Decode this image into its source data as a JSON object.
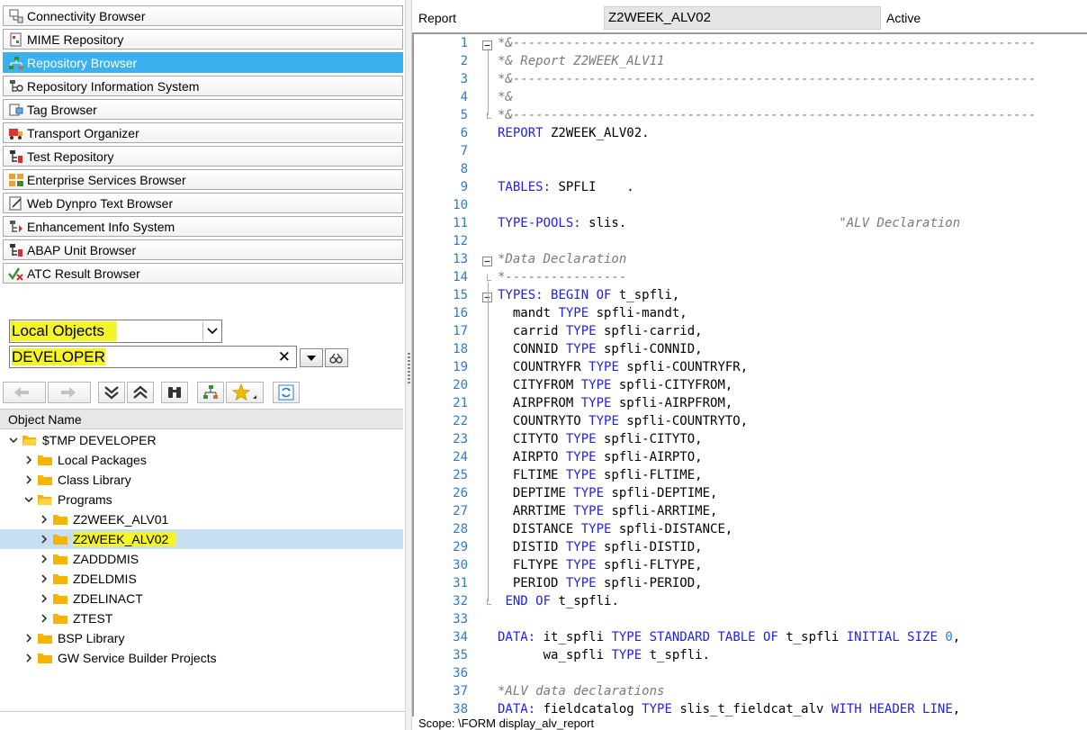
{
  "nav_buttons": [
    {
      "label": "Connectivity Browser",
      "icon": "connectivity-icon",
      "active": false
    },
    {
      "label": "MIME Repository",
      "icon": "mime-repository-icon",
      "active": false
    },
    {
      "label": "Repository Browser",
      "icon": "repository-browser-icon",
      "active": true
    },
    {
      "label": "Repository Information System",
      "icon": "repository-info-icon",
      "active": false
    },
    {
      "label": "Tag Browser",
      "icon": "tag-browser-icon",
      "active": false
    },
    {
      "label": "Transport Organizer",
      "icon": "transport-icon",
      "active": false
    },
    {
      "label": "Test Repository",
      "icon": "test-repository-icon",
      "active": false
    },
    {
      "label": "Enterprise Services Browser",
      "icon": "enterprise-services-icon",
      "active": false
    },
    {
      "label": "Web Dynpro Text Browser",
      "icon": "web-dynpro-icon",
      "active": false
    },
    {
      "label": "Enhancement Info System",
      "icon": "enhancement-icon",
      "active": false
    },
    {
      "label": "ABAP Unit Browser",
      "icon": "abap-unit-icon",
      "active": false
    },
    {
      "label": "ATC Result Browser",
      "icon": "atc-result-icon",
      "active": false
    }
  ],
  "object_selector": {
    "selected": "Local Objects",
    "user_value": "DEVELOPER"
  },
  "tree": {
    "header": "Object Name",
    "rows": [
      {
        "label": "$TMP DEVELOPER",
        "level": 0,
        "expanded": true,
        "selected": false,
        "highlight": false
      },
      {
        "label": "Local Packages",
        "level": 1,
        "expanded": false,
        "selected": false,
        "highlight": false
      },
      {
        "label": "Class Library",
        "level": 1,
        "expanded": false,
        "selected": false,
        "highlight": false
      },
      {
        "label": "Programs",
        "level": 1,
        "expanded": true,
        "selected": false,
        "highlight": false
      },
      {
        "label": "Z2WEEK_ALV01",
        "level": 2,
        "expanded": false,
        "selected": false,
        "highlight": false
      },
      {
        "label": "Z2WEEK_ALV02",
        "level": 2,
        "expanded": false,
        "selected": true,
        "highlight": true
      },
      {
        "label": "ZADDDMIS",
        "level": 2,
        "expanded": false,
        "selected": false,
        "highlight": false
      },
      {
        "label": "ZDELDMIS",
        "level": 2,
        "expanded": false,
        "selected": false,
        "highlight": false
      },
      {
        "label": "ZDELINACT",
        "level": 2,
        "expanded": false,
        "selected": false,
        "highlight": false
      },
      {
        "label": "ZTEST",
        "level": 2,
        "expanded": false,
        "selected": false,
        "highlight": false
      },
      {
        "label": "BSP Library",
        "level": 1,
        "expanded": false,
        "selected": false,
        "highlight": false
      },
      {
        "label": "GW Service Builder Projects",
        "level": 1,
        "expanded": false,
        "selected": false,
        "highlight": false
      }
    ]
  },
  "editor_header": {
    "label": "Report",
    "program": "Z2WEEK_ALV02",
    "status": "Active"
  },
  "code_lines": [
    {
      "n": "1",
      "fold": "minus",
      "parts": [
        [
          "cm",
          "*&---------------------------------------------------------------------"
        ]
      ]
    },
    {
      "n": "2",
      "fold": "",
      "parts": [
        [
          "cm",
          "*& Report Z2WEEK_ALV11"
        ]
      ]
    },
    {
      "n": "3",
      "fold": "",
      "parts": [
        [
          "cm",
          "*&---------------------------------------------------------------------"
        ]
      ]
    },
    {
      "n": "4",
      "fold": "",
      "parts": [
        [
          "cm",
          "*&"
        ]
      ]
    },
    {
      "n": "5",
      "fold": "end",
      "parts": [
        [
          "cm",
          "*&---------------------------------------------------------------------"
        ]
      ]
    },
    {
      "n": "6",
      "fold": "",
      "parts": [
        [
          "kw",
          "REPORT"
        ],
        [
          "",
          " Z2WEEK_ALV02."
        ]
      ]
    },
    {
      "n": "7",
      "fold": "",
      "parts": []
    },
    {
      "n": "8",
      "fold": "",
      "parts": []
    },
    {
      "n": "9",
      "fold": "",
      "parts": [
        [
          "kw",
          "TABLES:"
        ],
        [
          "",
          " SPFLI    ."
        ]
      ]
    },
    {
      "n": "10",
      "fold": "",
      "parts": []
    },
    {
      "n": "11",
      "fold": "",
      "parts": [
        [
          "kw",
          "TYPE-POOLS:"
        ],
        [
          "",
          " slis.                            "
        ],
        [
          "cm",
          "\"ALV Declaration"
        ]
      ]
    },
    {
      "n": "12",
      "fold": "",
      "parts": []
    },
    {
      "n": "13",
      "fold": "minus",
      "parts": [
        [
          "cm",
          "*Data Declaration"
        ]
      ]
    },
    {
      "n": "14",
      "fold": "end",
      "parts": [
        [
          "cm",
          "*----------------"
        ]
      ]
    },
    {
      "n": "15",
      "fold": "minus",
      "parts": [
        [
          "kw",
          "TYPES:"
        ],
        [
          "",
          " "
        ],
        [
          "kw",
          "BEGIN OF"
        ],
        [
          "",
          " t_spfli,"
        ]
      ]
    },
    {
      "n": "16",
      "fold": "",
      "parts": [
        [
          "",
          "  mandt "
        ],
        [
          "kw",
          "TYPE"
        ],
        [
          "",
          " spfli-mandt,"
        ]
      ]
    },
    {
      "n": "17",
      "fold": "",
      "parts": [
        [
          "",
          "  carrid "
        ],
        [
          "kw",
          "TYPE"
        ],
        [
          "",
          " spfli-carrid,"
        ]
      ]
    },
    {
      "n": "18",
      "fold": "",
      "parts": [
        [
          "",
          "  CONNID "
        ],
        [
          "kw",
          "TYPE"
        ],
        [
          "",
          " spfli-CONNID,"
        ]
      ]
    },
    {
      "n": "19",
      "fold": "",
      "parts": [
        [
          "",
          "  COUNTRYFR "
        ],
        [
          "kw",
          "TYPE"
        ],
        [
          "",
          " spfli-COUNTRYFR,"
        ]
      ]
    },
    {
      "n": "20",
      "fold": "",
      "parts": [
        [
          "",
          "  CITYFROM "
        ],
        [
          "kw",
          "TYPE"
        ],
        [
          "",
          " spfli-CITYFROM,"
        ]
      ]
    },
    {
      "n": "21",
      "fold": "",
      "parts": [
        [
          "",
          "  AIRPFROM "
        ],
        [
          "kw",
          "TYPE"
        ],
        [
          "",
          " spfli-AIRPFROM,"
        ]
      ]
    },
    {
      "n": "22",
      "fold": "",
      "parts": [
        [
          "",
          "  COUNTRYTO "
        ],
        [
          "kw",
          "TYPE"
        ],
        [
          "",
          " spfli-COUNTRYTO,"
        ]
      ]
    },
    {
      "n": "23",
      "fold": "",
      "parts": [
        [
          "",
          "  CITYTO "
        ],
        [
          "kw",
          "TYPE"
        ],
        [
          "",
          " spfli-CITYTO,"
        ]
      ]
    },
    {
      "n": "24",
      "fold": "",
      "parts": [
        [
          "",
          "  AIRPTO "
        ],
        [
          "kw",
          "TYPE"
        ],
        [
          "",
          " spfli-AIRPTO,"
        ]
      ]
    },
    {
      "n": "25",
      "fold": "",
      "parts": [
        [
          "",
          "  FLTIME "
        ],
        [
          "kw",
          "TYPE"
        ],
        [
          "",
          " spfli-FLTIME,"
        ]
      ]
    },
    {
      "n": "26",
      "fold": "",
      "parts": [
        [
          "",
          "  DEPTIME "
        ],
        [
          "kw",
          "TYPE"
        ],
        [
          "",
          " spfli-DEPTIME,"
        ]
      ]
    },
    {
      "n": "27",
      "fold": "",
      "parts": [
        [
          "",
          "  ARRTIME "
        ],
        [
          "kw",
          "TYPE"
        ],
        [
          "",
          " spfli-ARRTIME,"
        ]
      ]
    },
    {
      "n": "28",
      "fold": "",
      "parts": [
        [
          "",
          "  DISTANCE "
        ],
        [
          "kw",
          "TYPE"
        ],
        [
          "",
          " spfli-DISTANCE,"
        ]
      ]
    },
    {
      "n": "29",
      "fold": "",
      "parts": [
        [
          "",
          "  DISTID "
        ],
        [
          "kw",
          "TYPE"
        ],
        [
          "",
          " spfli-DISTID,"
        ]
      ]
    },
    {
      "n": "30",
      "fold": "",
      "parts": [
        [
          "",
          "  FLTYPE "
        ],
        [
          "kw",
          "TYPE"
        ],
        [
          "",
          " spfli-FLTYPE,"
        ]
      ]
    },
    {
      "n": "31",
      "fold": "",
      "parts": [
        [
          "",
          "  PERIOD "
        ],
        [
          "kw",
          "TYPE"
        ],
        [
          "",
          " spfli-PERIOD,"
        ]
      ]
    },
    {
      "n": "32",
      "fold": "end",
      "parts": [
        [
          "",
          " "
        ],
        [
          "kw",
          "END OF"
        ],
        [
          "",
          " t_spfli."
        ]
      ]
    },
    {
      "n": "33",
      "fold": "",
      "parts": []
    },
    {
      "n": "34",
      "fold": "",
      "parts": [
        [
          "kw",
          "DATA:"
        ],
        [
          "",
          " it_spfli "
        ],
        [
          "kw",
          "TYPE STANDARD TABLE OF"
        ],
        [
          "",
          " t_spfli "
        ],
        [
          "kw",
          "INITIAL SIZE"
        ],
        [
          "",
          " "
        ],
        [
          "num",
          "0"
        ],
        [
          "",
          ","
        ]
      ]
    },
    {
      "n": "35",
      "fold": "",
      "parts": [
        [
          "",
          "      wa_spfli "
        ],
        [
          "kw",
          "TYPE"
        ],
        [
          "",
          " t_spfli."
        ]
      ]
    },
    {
      "n": "36",
      "fold": "",
      "parts": []
    },
    {
      "n": "37",
      "fold": "",
      "parts": [
        [
          "cm",
          "*ALV data declarations"
        ]
      ]
    },
    {
      "n": "38",
      "fold": "",
      "parts": [
        [
          "kw",
          "DATA:"
        ],
        [
          "",
          " fieldcatalog "
        ],
        [
          "kw",
          "TYPE"
        ],
        [
          "",
          " slis_t_fieldcat_alv "
        ],
        [
          "kw",
          "WITH HEADER LINE"
        ],
        [
          "",
          ","
        ]
      ]
    }
  ],
  "status_bar": {
    "text": "Scope: \\FORM display_alv_report"
  },
  "colors": {
    "active_nav": "#3bb1ee",
    "keyword": "#1f1ff0",
    "comment": "#7a7a7a",
    "line_number": "#2a7ad4",
    "highlight": "#f4f428",
    "tree_selection": "#c7dff0",
    "folder": "#f5b400"
  }
}
